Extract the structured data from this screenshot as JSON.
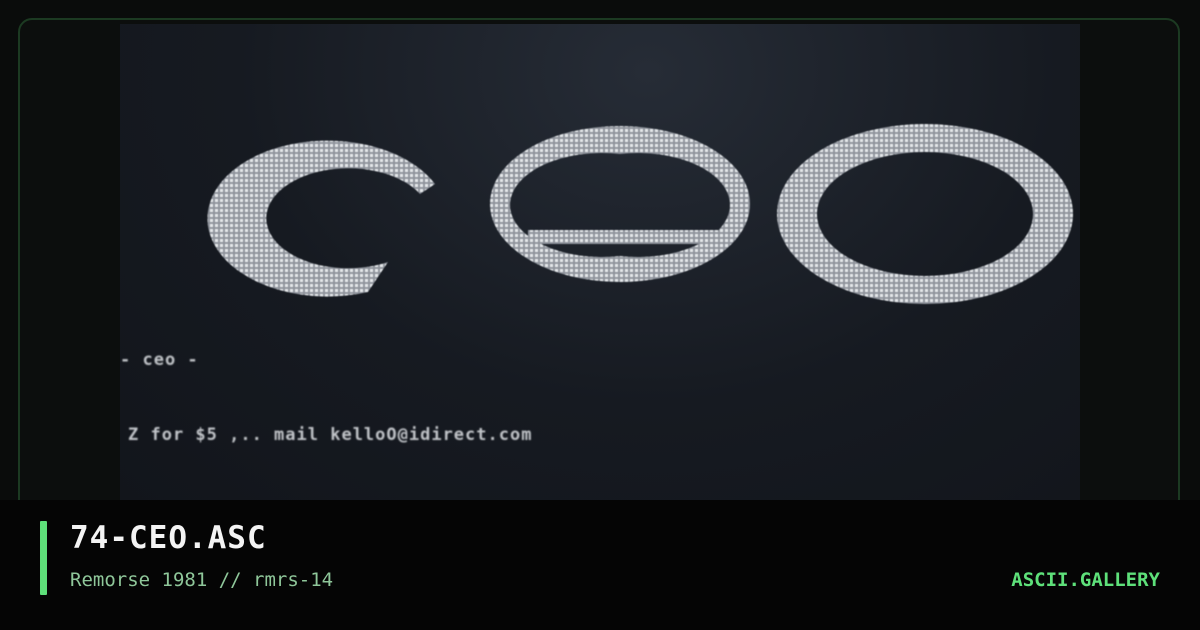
{
  "artwork": {
    "logo_text": "ceo",
    "line_1": "- ceo -",
    "line_2": "Z for $5 ,.. mail kelloO@idirect.com"
  },
  "caption": {
    "title": "74-CEO.ASC",
    "subtitle": "Remorse 1981 // rmrs-14",
    "brand": "ASCII.GALLERY"
  },
  "colors": {
    "accent": "#5ee07a",
    "subtitle": "#8fc79a",
    "art": "#d6d9dd",
    "preview_bg": "#161a21"
  }
}
